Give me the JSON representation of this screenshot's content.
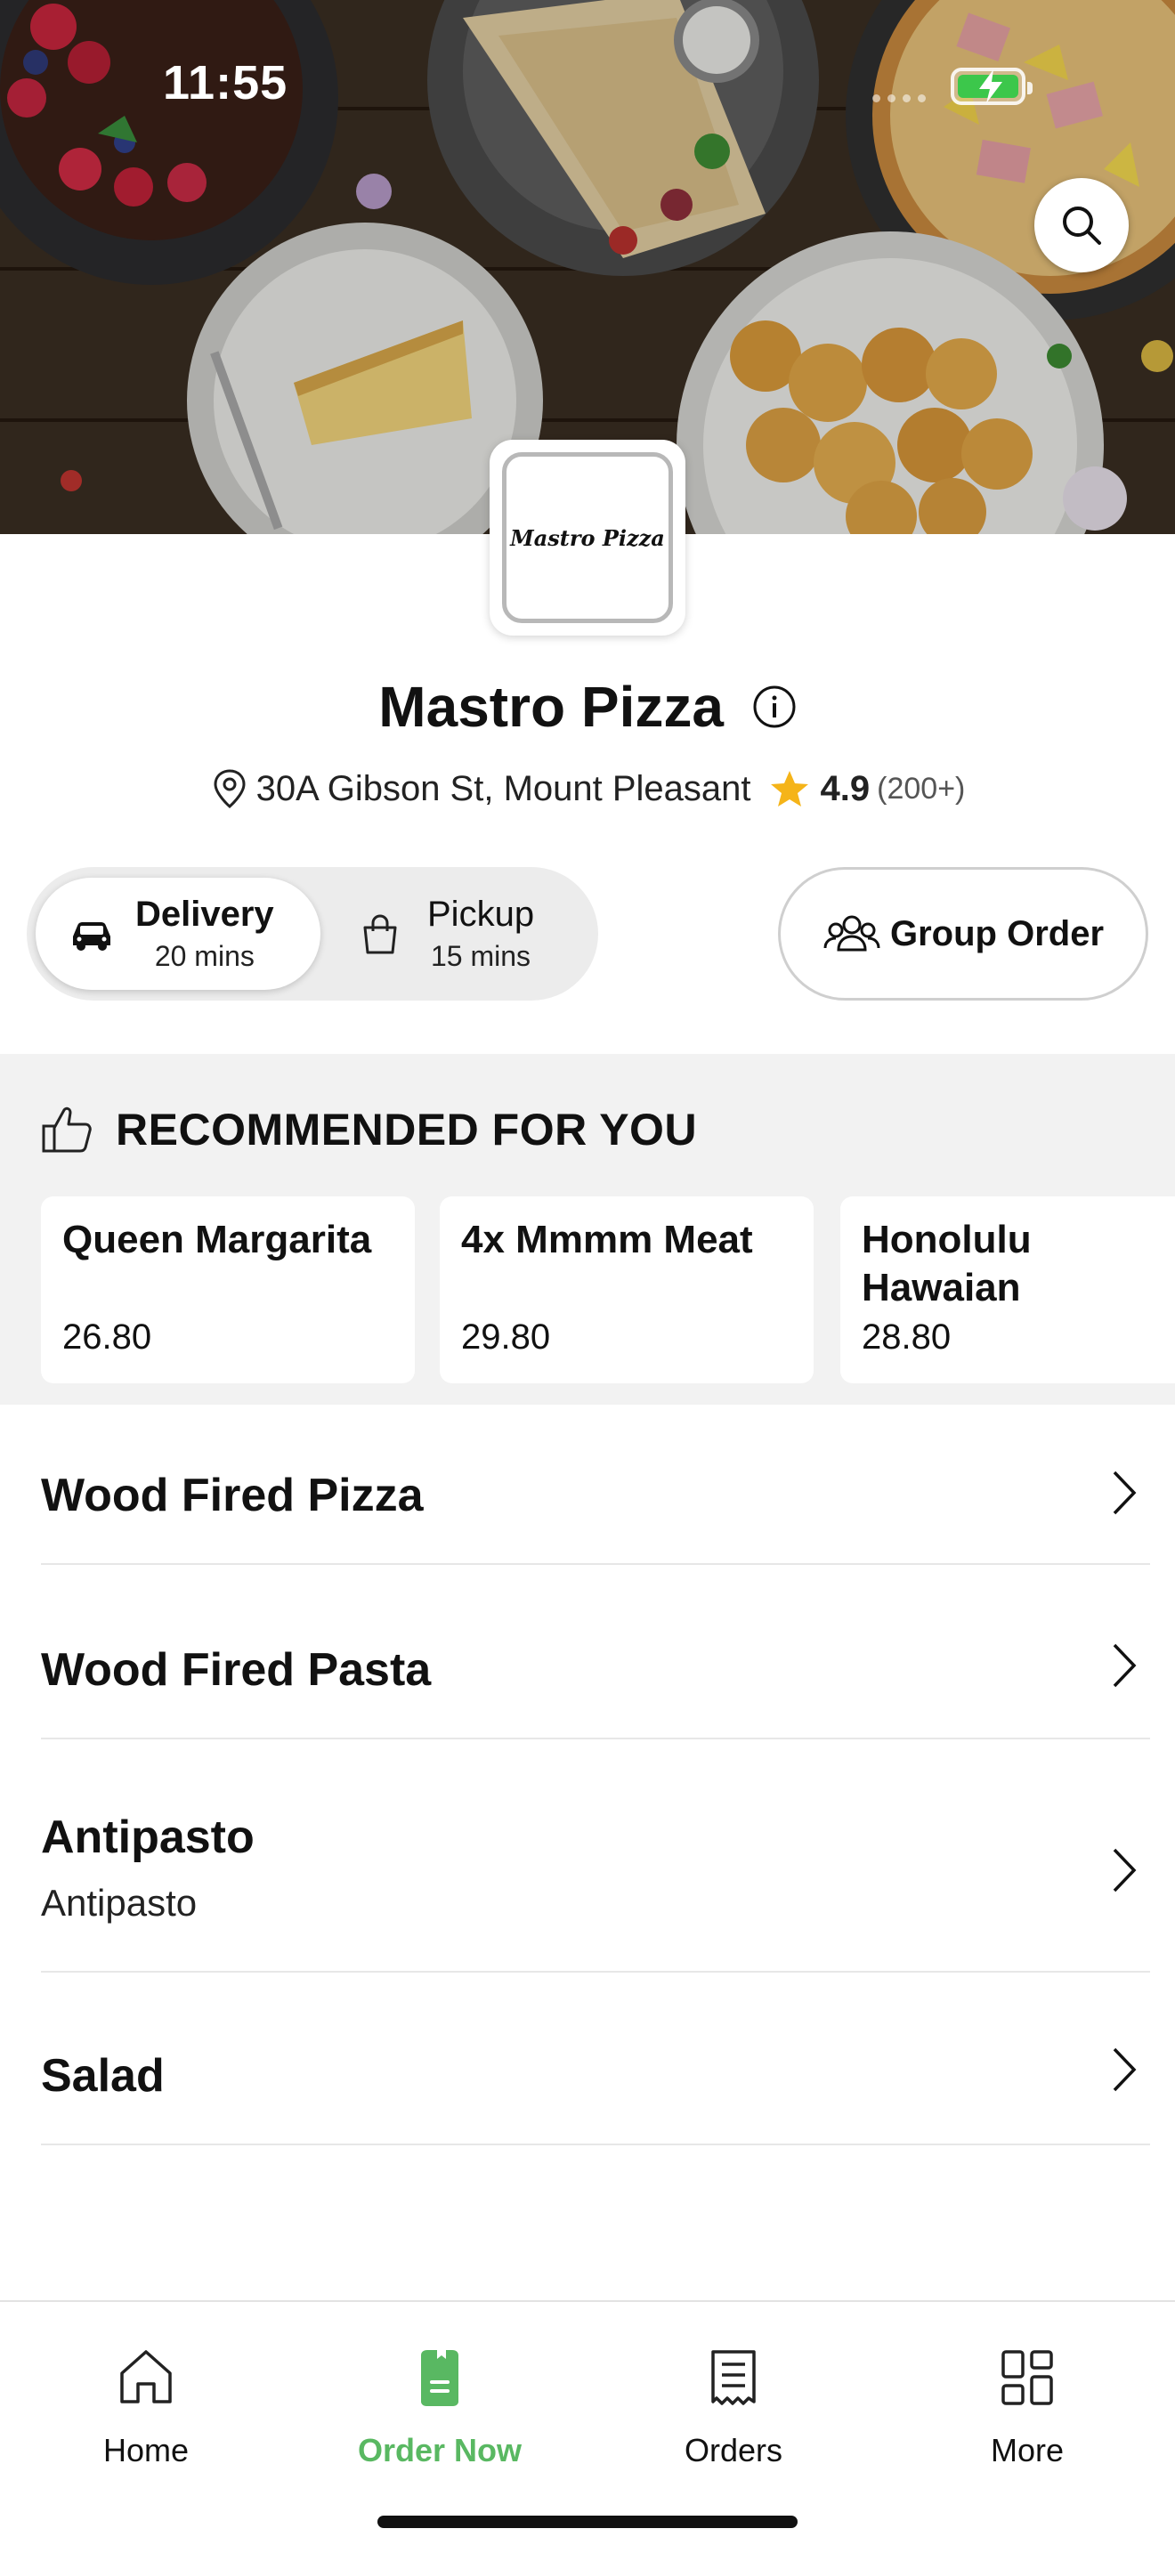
{
  "status_bar": {
    "time": "11:55"
  },
  "restaurant": {
    "logo_text": "Mastro Pizza",
    "name": "Mastro Pizza",
    "address": "30A Gibson St, Mount Pleasant",
    "rating": "4.9",
    "rating_count": "(200+)"
  },
  "order_mode": {
    "selected": "Delivery",
    "options": [
      {
        "label": "Delivery",
        "time": "20 mins",
        "icon": "car-icon"
      },
      {
        "label": "Pickup",
        "time": "15 mins",
        "icon": "shopping-bag-icon"
      }
    ]
  },
  "group_order": {
    "label": "Group Order",
    "icon": "group-icon"
  },
  "recommended": {
    "title": "RECOMMENDED FOR YOU",
    "icon": "thumbs-up-icon",
    "items": [
      {
        "name": "Queen Margarita",
        "price": "26.80"
      },
      {
        "name": "4x Mmmm Meat",
        "price": "29.80"
      },
      {
        "name": "Honolulu Hawaian",
        "price": "28.80"
      }
    ]
  },
  "categories": [
    {
      "title": "Wood Fired Pizza",
      "subtitle": ""
    },
    {
      "title": "Wood Fired Pasta",
      "subtitle": ""
    },
    {
      "title": "Antipasto",
      "subtitle": "Antipasto"
    },
    {
      "title": "Salad",
      "subtitle": ""
    }
  ],
  "tabbar": {
    "active": "Order Now",
    "active_color": "#59b862",
    "tabs": [
      {
        "label": "Home",
        "icon": "home-icon"
      },
      {
        "label": "Order Now",
        "icon": "order-icon"
      },
      {
        "label": "Orders",
        "icon": "receipt-icon"
      },
      {
        "label": "More",
        "icon": "grid-icon"
      }
    ]
  }
}
